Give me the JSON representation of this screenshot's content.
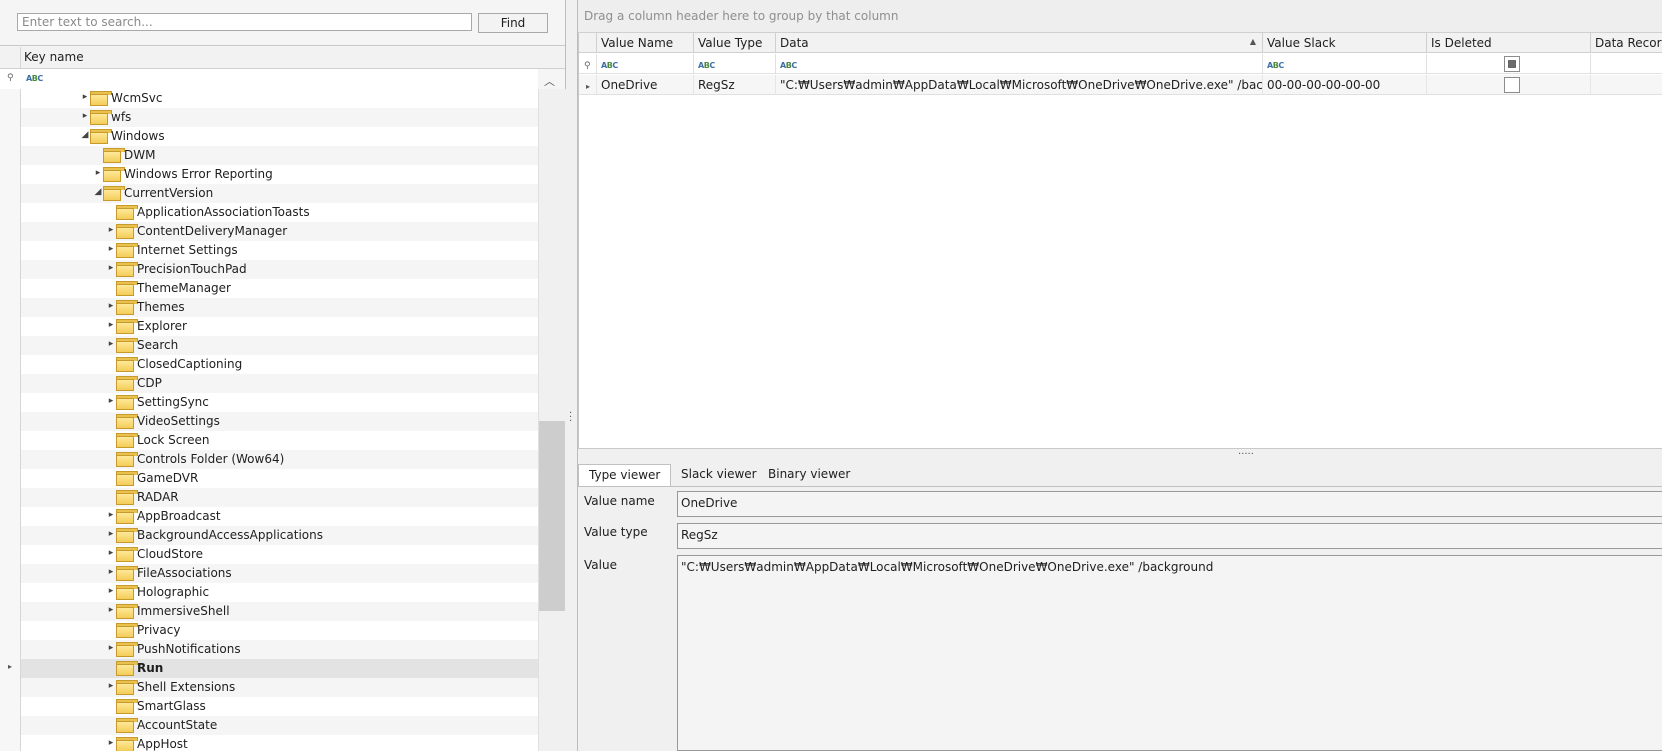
{
  "search": {
    "placeholder": "Enter text to search...",
    "value": "",
    "find_label": "Find"
  },
  "tree": {
    "header": "Key name",
    "rows": [
      {
        "label": "WcmSvc",
        "level": 0,
        "expander": "collapsed"
      },
      {
        "label": "wfs",
        "level": 0,
        "expander": "collapsed"
      },
      {
        "label": "Windows",
        "level": 0,
        "expander": "expanded"
      },
      {
        "label": "DWM",
        "level": 1,
        "expander": "none"
      },
      {
        "label": "Windows Error Reporting",
        "level": 1,
        "expander": "collapsed"
      },
      {
        "label": "CurrentVersion",
        "level": 1,
        "expander": "expanded"
      },
      {
        "label": "ApplicationAssociationToasts",
        "level": 2,
        "expander": "none"
      },
      {
        "label": "ContentDeliveryManager",
        "level": 2,
        "expander": "collapsed"
      },
      {
        "label": "Internet Settings",
        "level": 2,
        "expander": "collapsed"
      },
      {
        "label": "PrecisionTouchPad",
        "level": 2,
        "expander": "collapsed"
      },
      {
        "label": "ThemeManager",
        "level": 2,
        "expander": "none"
      },
      {
        "label": "Themes",
        "level": 2,
        "expander": "collapsed"
      },
      {
        "label": "Explorer",
        "level": 2,
        "expander": "collapsed"
      },
      {
        "label": "Search",
        "level": 2,
        "expander": "collapsed"
      },
      {
        "label": "ClosedCaptioning",
        "level": 2,
        "expander": "none"
      },
      {
        "label": "CDP",
        "level": 2,
        "expander": "none"
      },
      {
        "label": "SettingSync",
        "level": 2,
        "expander": "collapsed"
      },
      {
        "label": "VideoSettings",
        "level": 2,
        "expander": "none"
      },
      {
        "label": "Lock Screen",
        "level": 2,
        "expander": "none"
      },
      {
        "label": "Controls Folder (Wow64)",
        "level": 2,
        "expander": "none"
      },
      {
        "label": "GameDVR",
        "level": 2,
        "expander": "none"
      },
      {
        "label": "RADAR",
        "level": 2,
        "expander": "none"
      },
      {
        "label": "AppBroadcast",
        "level": 2,
        "expander": "collapsed"
      },
      {
        "label": "BackgroundAccessApplications",
        "level": 2,
        "expander": "collapsed"
      },
      {
        "label": "CloudStore",
        "level": 2,
        "expander": "collapsed"
      },
      {
        "label": "FileAssociations",
        "level": 2,
        "expander": "collapsed"
      },
      {
        "label": "Holographic",
        "level": 2,
        "expander": "collapsed"
      },
      {
        "label": "ImmersiveShell",
        "level": 2,
        "expander": "collapsed"
      },
      {
        "label": "Privacy",
        "level": 2,
        "expander": "none"
      },
      {
        "label": "PushNotifications",
        "level": 2,
        "expander": "collapsed"
      },
      {
        "label": "Run",
        "level": 2,
        "expander": "none",
        "selected": true
      },
      {
        "label": "Shell Extensions",
        "level": 2,
        "expander": "collapsed"
      },
      {
        "label": "SmartGlass",
        "level": 2,
        "expander": "none"
      },
      {
        "label": "AccountState",
        "level": 2,
        "expander": "none"
      },
      {
        "label": "AppHost",
        "level": 2,
        "expander": "collapsed"
      }
    ]
  },
  "grid": {
    "group_hint": "Drag a column header here to group by that column",
    "columns": [
      "Value Name",
      "Value Type",
      "Data",
      "Value Slack",
      "Is Deleted",
      "Data Record"
    ],
    "sorted_column": "Data",
    "sort_direction": "ascending",
    "rows": [
      {
        "value_name": "OneDrive",
        "value_type": "RegSz",
        "data": "\"C:₩Users₩admin₩AppData₩Local₩Microsoft₩OneDrive₩OneDrive.exe\" /background",
        "value_slack": "00-00-00-00-00-00",
        "is_deleted": false
      }
    ]
  },
  "viewer": {
    "tabs": [
      "Type viewer",
      "Slack viewer",
      "Binary viewer"
    ],
    "active_tab": "Type viewer",
    "value_name_label": "Value name",
    "value_name": "OneDrive",
    "value_type_label": "Value type",
    "value_type": "RegSz",
    "value_label": "Value",
    "value": "\"C:₩Users₩admin₩AppData₩Local₩Microsoft₩OneDrive₩OneDrive.exe\" /background"
  },
  "colors": {
    "folder": "#f3cd5a",
    "selected_row": "#e3e3e3",
    "background": "#f0f0f0"
  }
}
